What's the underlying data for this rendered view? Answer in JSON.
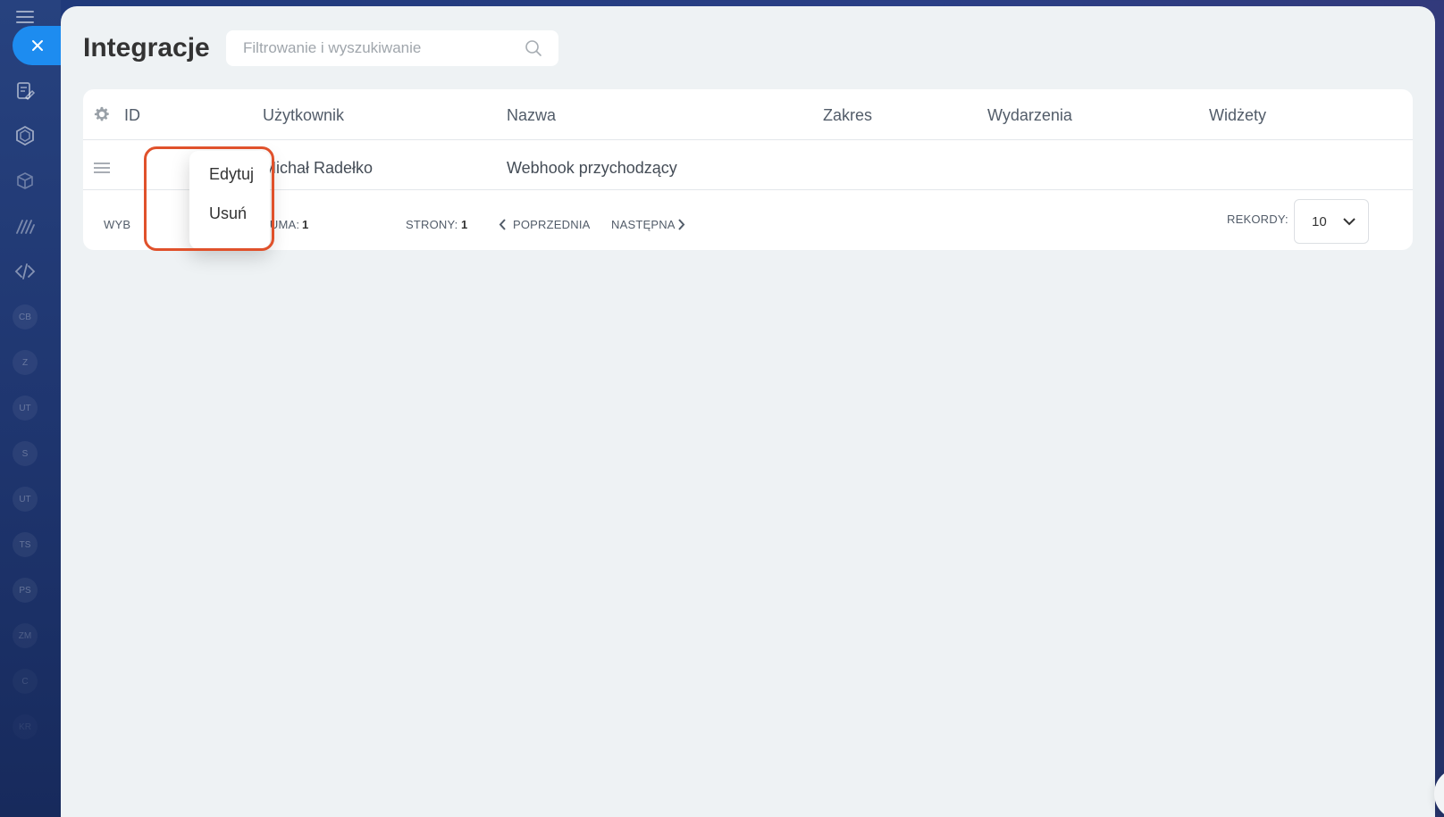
{
  "page": {
    "title": "Integracje",
    "search_placeholder": "Filtrowanie i wyszukiwanie"
  },
  "sidebar": {
    "circles": [
      "CB",
      "Z",
      "UT",
      "S",
      "UT",
      "TS",
      "PS",
      "ZM",
      "C",
      "KR"
    ]
  },
  "grid": {
    "columns": [
      "ID",
      "Użytkownik",
      "Nazwa",
      "Zakres",
      "Wydarzenia",
      "Widżety"
    ],
    "rows": [
      {
        "id": "",
        "user": "Michał Radełko",
        "name": "Webhook przychodzący",
        "scope": "",
        "events": "",
        "widgets": ""
      }
    ],
    "footer": {
      "selected_label": "WYB",
      "total_label": "SUMA:",
      "total_value": "1",
      "pages_label": "STRONY:",
      "pages_value": "1",
      "prev_label": "POPRZEDNIA",
      "next_label": "NASTĘPNA",
      "records_label": "REKORDY:",
      "records_value": "10"
    }
  },
  "context_menu": {
    "items": [
      "Edytuj",
      "Usuń"
    ]
  },
  "colors": {
    "accent": "#1d8cf0",
    "highlight": "#e0512b"
  }
}
